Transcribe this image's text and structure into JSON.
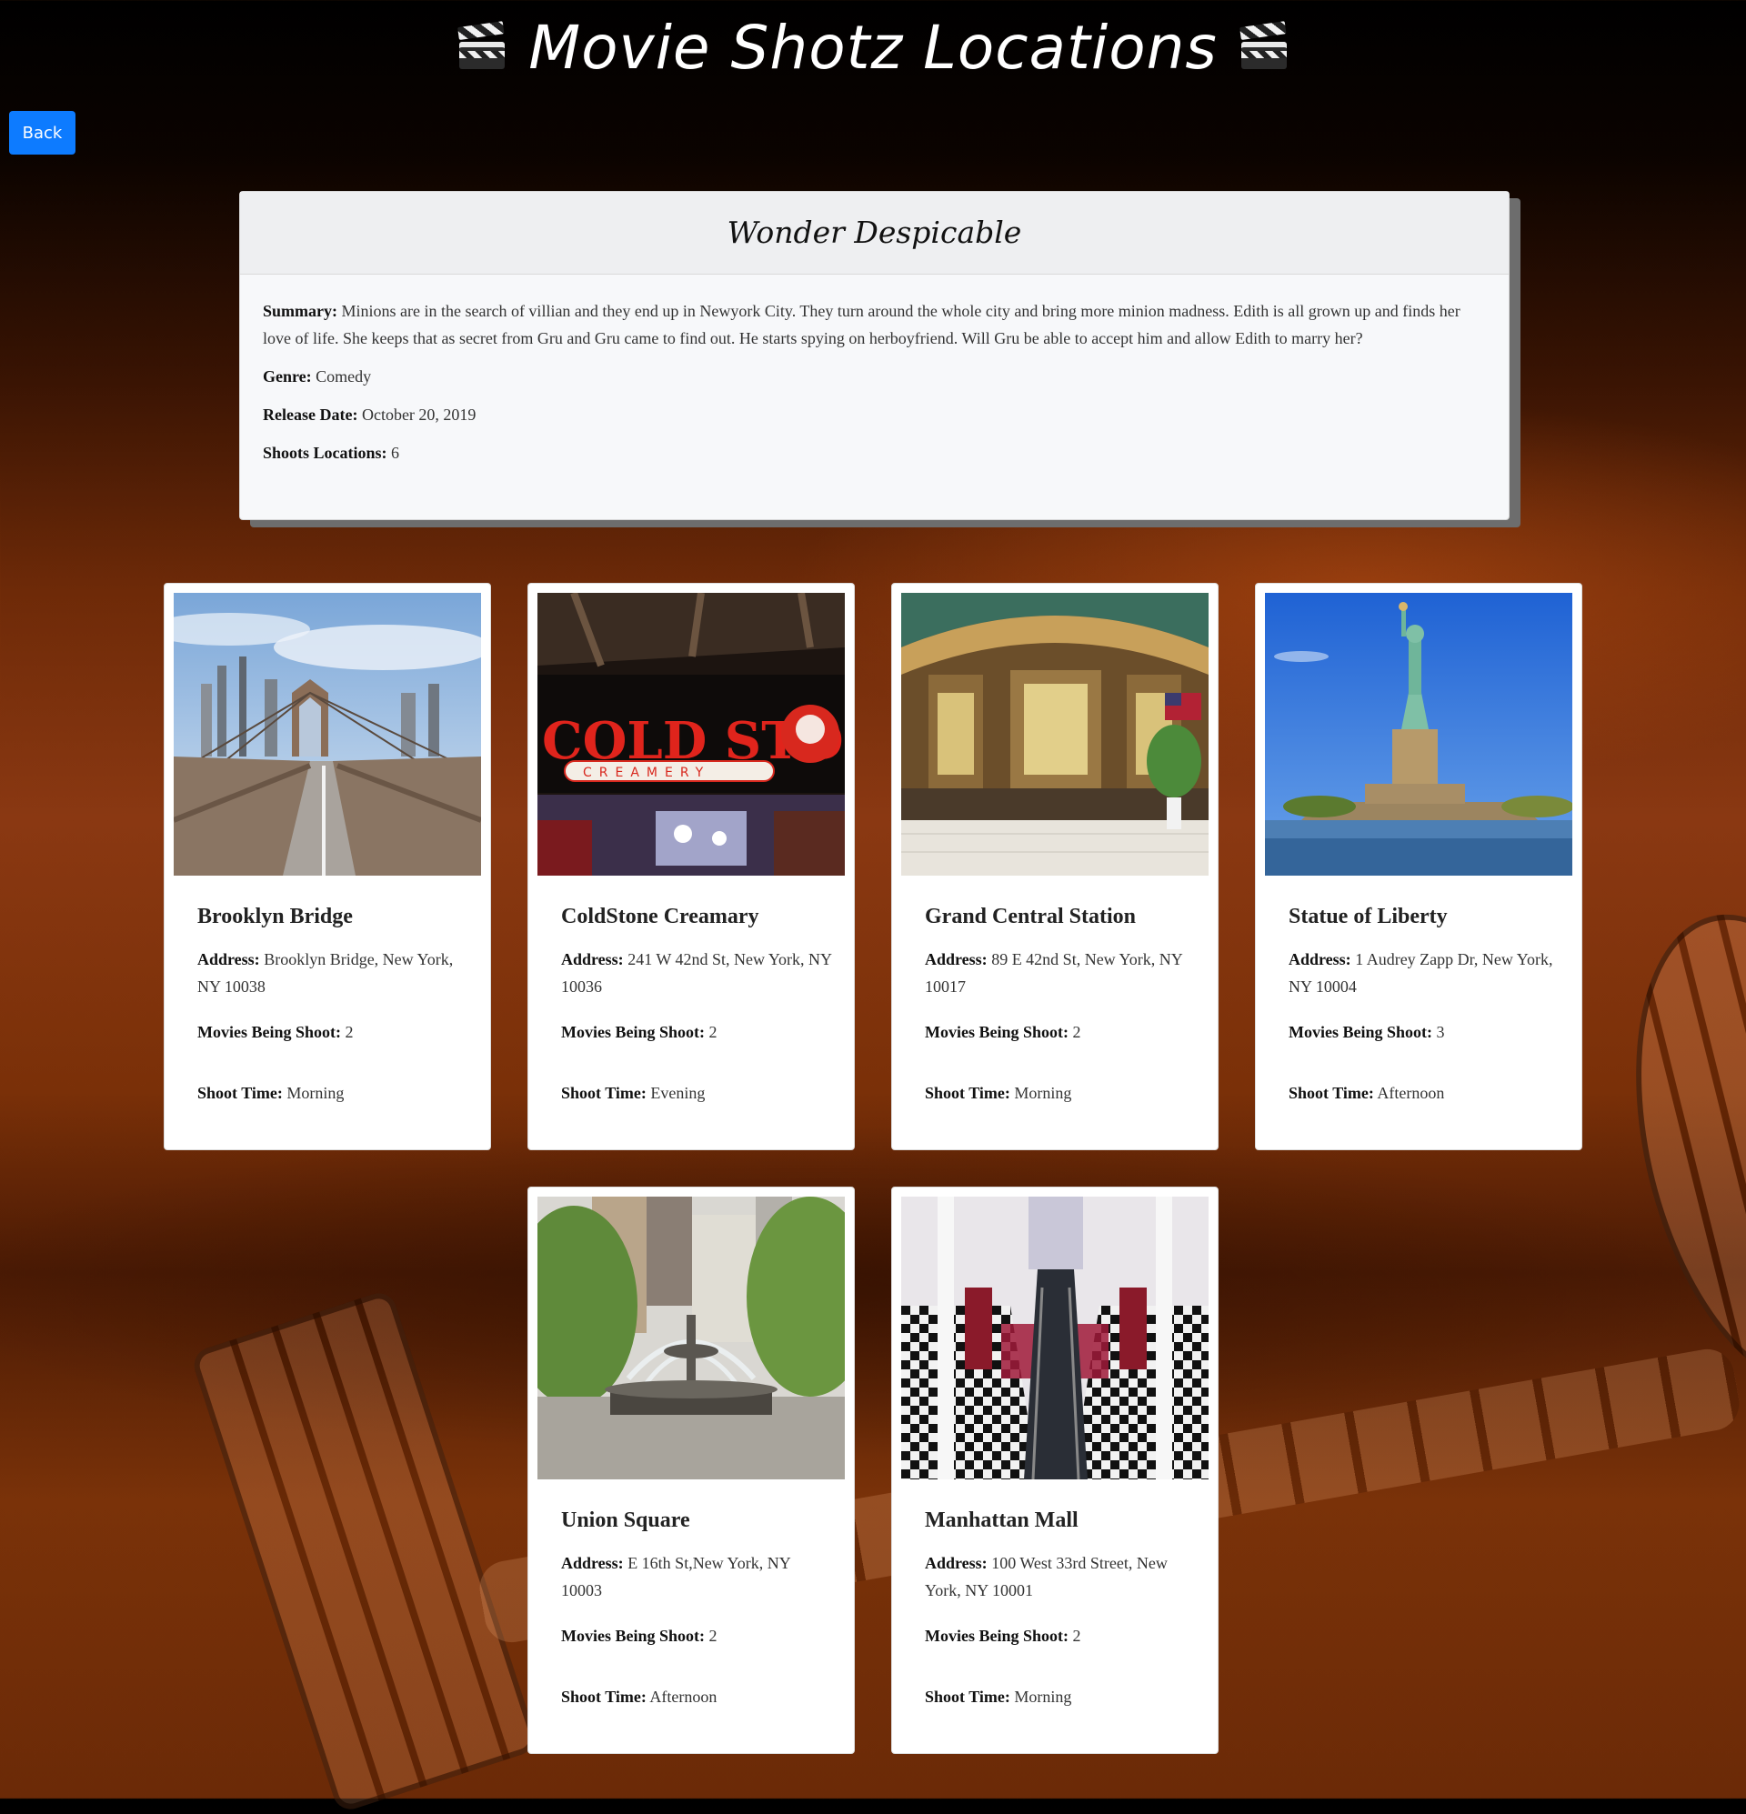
{
  "header": {
    "title": "Movie Shotz Locations",
    "icon": "clapperboard-icon"
  },
  "back_button": {
    "label": "Back",
    "color": "#0d7bff"
  },
  "movie": {
    "title": "Wonder Despicable",
    "summary_label": "Summary:",
    "summary": "Minions are in the search of villian and they end up in Newyork City. They turn around the whole city and bring more minion madness. Edith is all grown up and finds her love of life. She keeps that as secret from Gru and Gru came to find out. He starts spying on herboyfriend. Will Gru be able to accept him and allow Edith to marry her?",
    "genre_label": "Genre:",
    "genre": "Comedy",
    "release_label": "Release Date:",
    "release_date": "October 20, 2019",
    "locations_label": "Shoots Locations:",
    "locations_count": "6"
  },
  "labels": {
    "address": "Address:",
    "movies": "Movies Being Shoot:",
    "time": "Shoot Time:"
  },
  "locations": [
    {
      "name": "Brooklyn Bridge",
      "address": "Brooklyn Bridge, New York, NY 10038",
      "movies": "2",
      "time": "Morning",
      "image": "brooklyn-bridge-photo"
    },
    {
      "name": "ColdStone Creamary",
      "address": "241 W 42nd St, New York, NY 10036",
      "movies": "2",
      "time": "Evening",
      "image": "coldstone-creamery-photo",
      "sign_text": "COLD STONE",
      "sign_sub": "CREAMERY"
    },
    {
      "name": "Grand Central Station",
      "address": "89 E 42nd St, New York, NY 10017",
      "movies": "2",
      "time": "Morning",
      "image": "grand-central-photo"
    },
    {
      "name": "Statue of Liberty",
      "address": "1 Audrey Zapp Dr, New York, NY 10004",
      "movies": "3",
      "time": "Afternoon",
      "image": "statue-of-liberty-photo"
    },
    {
      "name": "Union Square",
      "address": "E 16th St,New York, NY 10003",
      "movies": "2",
      "time": "Afternoon",
      "image": "union-square-photo"
    },
    {
      "name": "Manhattan Mall",
      "address": "100 West 33rd Street, New York, NY 10001",
      "movies": "2",
      "time": "Morning",
      "image": "manhattan-mall-photo"
    }
  ]
}
